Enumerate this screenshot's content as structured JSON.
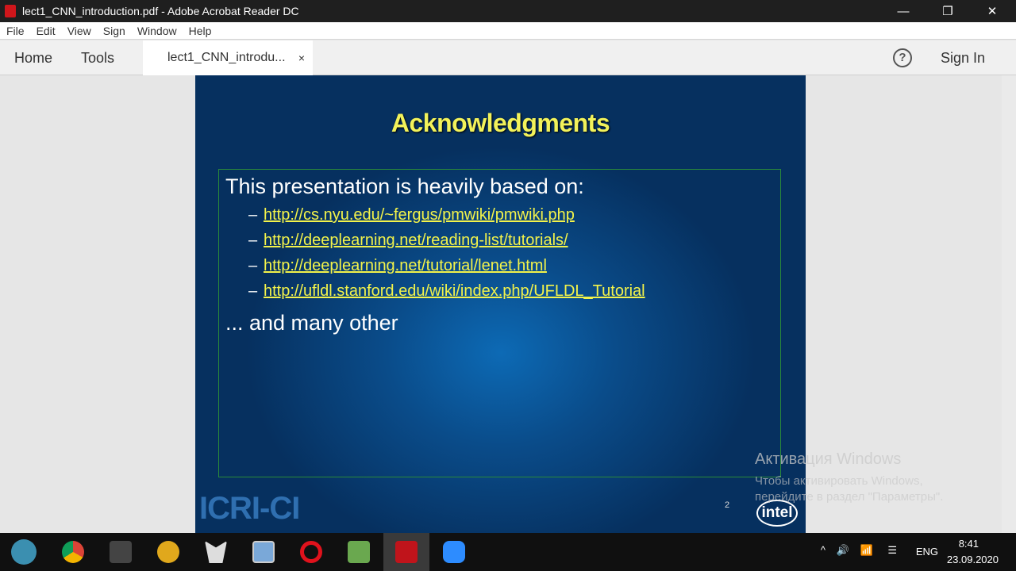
{
  "window": {
    "title": "lect1_CNN_introduction.pdf - Adobe Acrobat Reader DC",
    "minimize": "—",
    "restore": "❐",
    "close": "✕"
  },
  "menu": [
    "File",
    "Edit",
    "View",
    "Sign",
    "Window",
    "Help"
  ],
  "tabs": {
    "home": "Home",
    "tools": "Tools",
    "doc": "lect1_CNN_introdu...",
    "close": "×",
    "help": "?",
    "signin": "Sign In"
  },
  "slide": {
    "title": "Acknowledgments",
    "lead": "This presentation is heavily based on:",
    "links": [
      "http://cs.nyu.edu/~fergus/pmwiki/pmwiki.php",
      "http://deeplearning.net/reading-list/tutorials/",
      "http://deeplearning.net/tutorial/lenet.html",
      "http://ufldl.stanford.edu/wiki/index.php/UFLDL_Tutorial"
    ],
    "dash": "–",
    "other": "... and many other",
    "logo": "ICRI-CI",
    "page": "2",
    "intel": "intel"
  },
  "watermark": {
    "title": "Активация Windows",
    "text": "Чтобы активировать Windows, перейдите в раздел \"Параметры\"."
  },
  "tray": {
    "lang": "ENG",
    "time": "8:41",
    "date": "23.09.2020"
  }
}
